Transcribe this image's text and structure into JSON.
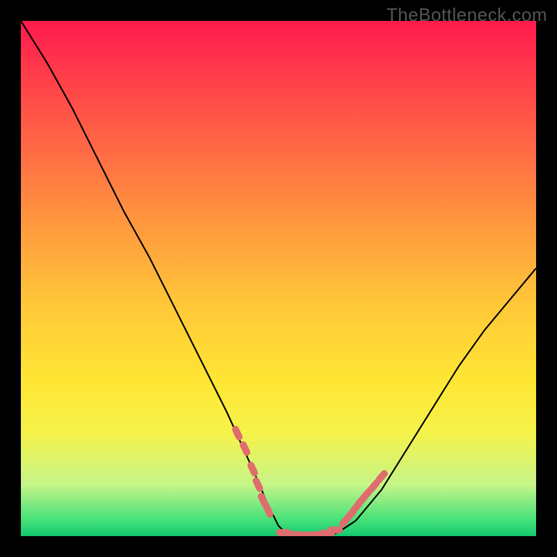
{
  "watermark": "TheBottleneck.com",
  "colors": {
    "background": "#000000",
    "curve": "#000000",
    "marker": "#e06d6d",
    "gradient_top": "#ff1a4d",
    "gradient_bottom": "#12c96e"
  },
  "chart_data": {
    "type": "line",
    "title": "",
    "xlabel": "",
    "ylabel": "",
    "xlim": [
      0,
      100
    ],
    "ylim": [
      0,
      100
    ],
    "grid": false,
    "legend": false,
    "x": [
      0,
      5,
      10,
      15,
      20,
      25,
      30,
      35,
      40,
      45,
      48,
      50,
      52,
      55,
      58,
      60,
      62,
      65,
      70,
      75,
      80,
      85,
      90,
      95,
      100
    ],
    "values": [
      100,
      92,
      83,
      73,
      63,
      54,
      44,
      34,
      24,
      13,
      6,
      2,
      0,
      0,
      0,
      0,
      1,
      3,
      9,
      17,
      25,
      33,
      40,
      46,
      52
    ],
    "markers": {
      "left_cluster": {
        "x": [
          42,
          43.5,
          45,
          46,
          47,
          48
        ],
        "y": [
          20,
          17,
          13,
          10,
          7,
          5
        ]
      },
      "bottom_cluster": {
        "x": [
          51,
          53,
          55,
          56.5,
          58,
          59.5,
          61
        ],
        "y": [
          0.7,
          0.3,
          0.2,
          0.2,
          0.3,
          0.6,
          1.2
        ]
      },
      "right_cluster": {
        "x": [
          63,
          64,
          65,
          66,
          67,
          68.5,
          70
        ],
        "y": [
          3,
          4.2,
          5.5,
          6.8,
          8,
          9.7,
          11.5
        ]
      }
    }
  }
}
